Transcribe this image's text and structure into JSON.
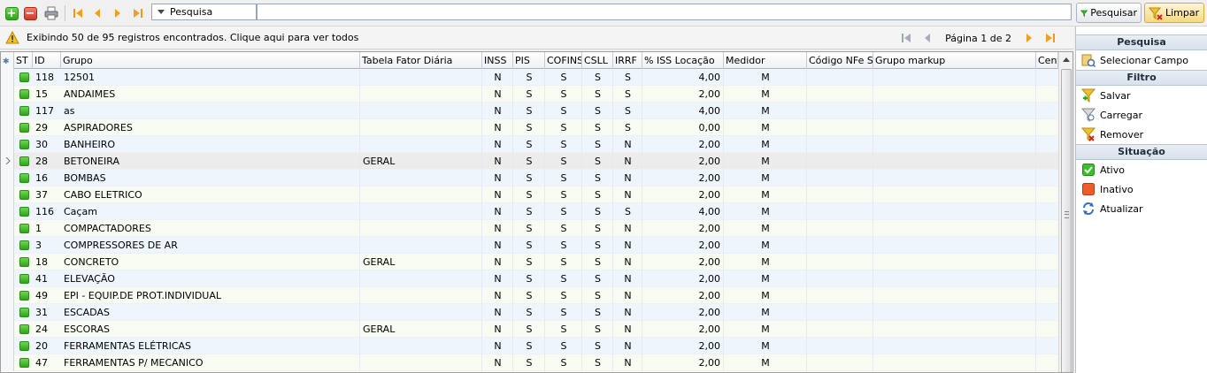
{
  "toolbar": {
    "add_icon": "plus-icon",
    "remove_icon": "minus-icon",
    "print_icon": "printer-icon",
    "search_dropdown_label": "Pesquisa",
    "search_value": "",
    "pesquisar_label": "Pesquisar",
    "limpar_label": "Limpar"
  },
  "infobar": {
    "message": "Exibindo 50 de 95 registros encontrados. Clique aqui para ver todos",
    "page_text": "Página 1 de 2"
  },
  "grid": {
    "columns": [
      "ST",
      "ID",
      "Grupo",
      "Tabela Fator Diária",
      "INSS",
      "PIS",
      "COFINS",
      "CSLL",
      "IRRF",
      "% ISS Locação",
      "Medidor",
      "Código NFe SP",
      "Grupo markup",
      "Cent"
    ],
    "rows": [
      {
        "id": "118",
        "grupo": "12501",
        "tabela": "",
        "inss": "N",
        "pis": "S",
        "cofins": "S",
        "csll": "S",
        "irrf": "S",
        "iss": "4,00",
        "medidor": "M"
      },
      {
        "id": "15",
        "grupo": "ANDAIMES",
        "tabela": "",
        "inss": "N",
        "pis": "S",
        "cofins": "S",
        "csll": "S",
        "irrf": "S",
        "iss": "2,00",
        "medidor": "M"
      },
      {
        "id": "117",
        "grupo": "as",
        "tabela": "",
        "inss": "N",
        "pis": "S",
        "cofins": "S",
        "csll": "S",
        "irrf": "S",
        "iss": "4,00",
        "medidor": "M"
      },
      {
        "id": "29",
        "grupo": "ASPIRADORES",
        "tabela": "",
        "inss": "N",
        "pis": "S",
        "cofins": "S",
        "csll": "S",
        "irrf": "S",
        "iss": "0,00",
        "medidor": "M"
      },
      {
        "id": "30",
        "grupo": "BANHEIRO",
        "tabela": "",
        "inss": "N",
        "pis": "S",
        "cofins": "S",
        "csll": "S",
        "irrf": "N",
        "iss": "2,00",
        "medidor": "M"
      },
      {
        "id": "28",
        "grupo": "BETONEIRA",
        "tabela": "GERAL",
        "inss": "N",
        "pis": "S",
        "cofins": "S",
        "csll": "S",
        "irrf": "N",
        "iss": "2,00",
        "medidor": "M"
      },
      {
        "id": "16",
        "grupo": "BOMBAS",
        "tabela": "",
        "inss": "N",
        "pis": "S",
        "cofins": "S",
        "csll": "S",
        "irrf": "N",
        "iss": "2,00",
        "medidor": "M"
      },
      {
        "id": "37",
        "grupo": "CABO ELETRICO",
        "tabela": "",
        "inss": "N",
        "pis": "S",
        "cofins": "S",
        "csll": "S",
        "irrf": "N",
        "iss": "2,00",
        "medidor": "M"
      },
      {
        "id": "116",
        "grupo": "Caçam",
        "tabela": "",
        "inss": "N",
        "pis": "S",
        "cofins": "S",
        "csll": "S",
        "irrf": "S",
        "iss": "4,00",
        "medidor": "M"
      },
      {
        "id": "1",
        "grupo": "COMPACTADORES",
        "tabela": "",
        "inss": "N",
        "pis": "S",
        "cofins": "S",
        "csll": "S",
        "irrf": "N",
        "iss": "2,00",
        "medidor": "M"
      },
      {
        "id": "3",
        "grupo": "COMPRESSORES DE AR",
        "tabela": "",
        "inss": "N",
        "pis": "S",
        "cofins": "S",
        "csll": "S",
        "irrf": "N",
        "iss": "2,00",
        "medidor": "M"
      },
      {
        "id": "18",
        "grupo": "CONCRETO",
        "tabela": "GERAL",
        "inss": "N",
        "pis": "S",
        "cofins": "S",
        "csll": "S",
        "irrf": "N",
        "iss": "2,00",
        "medidor": "M"
      },
      {
        "id": "41",
        "grupo": "ELEVAÇÃO",
        "tabela": "",
        "inss": "N",
        "pis": "S",
        "cofins": "S",
        "csll": "S",
        "irrf": "N",
        "iss": "2,00",
        "medidor": "M"
      },
      {
        "id": "49",
        "grupo": "EPI - EQUIP.DE PROT.INDIVIDUAL",
        "tabela": "",
        "inss": "N",
        "pis": "S",
        "cofins": "S",
        "csll": "S",
        "irrf": "N",
        "iss": "2,00",
        "medidor": "M"
      },
      {
        "id": "31",
        "grupo": "ESCADAS",
        "tabela": "",
        "inss": "N",
        "pis": "S",
        "cofins": "S",
        "csll": "S",
        "irrf": "N",
        "iss": "2,00",
        "medidor": "M"
      },
      {
        "id": "24",
        "grupo": "ESCORAS",
        "tabela": "GERAL",
        "inss": "N",
        "pis": "S",
        "cofins": "S",
        "csll": "S",
        "irrf": "N",
        "iss": "2,00",
        "medidor": "M"
      },
      {
        "id": "20",
        "grupo": "FERRAMENTAS ELÉTRICAS",
        "tabela": "",
        "inss": "N",
        "pis": "S",
        "cofins": "S",
        "csll": "S",
        "irrf": "N",
        "iss": "2,00",
        "medidor": "M"
      },
      {
        "id": "47",
        "grupo": "FERRAMENTAS P/ MECANICO",
        "tabela": "",
        "inss": "N",
        "pis": "S",
        "cofins": "S",
        "csll": "S",
        "irrf": "N",
        "iss": "2,00",
        "medidor": "M"
      }
    ],
    "selected_row": 5
  },
  "side": {
    "pesquisa_title": "Pesquisa",
    "selecionar_campo": "Selecionar Campo",
    "filtro_title": "Filtro",
    "salvar": "Salvar",
    "carregar": "Carregar",
    "remover": "Remover",
    "situacao_title": "Situação",
    "ativo": "Ativo",
    "inativo": "Inativo",
    "atualizar": "Atualizar"
  },
  "colors": {
    "status_active": "#2ea41a",
    "accent_blue": "#2f6fc4",
    "nav_orange": "#f0a020"
  }
}
